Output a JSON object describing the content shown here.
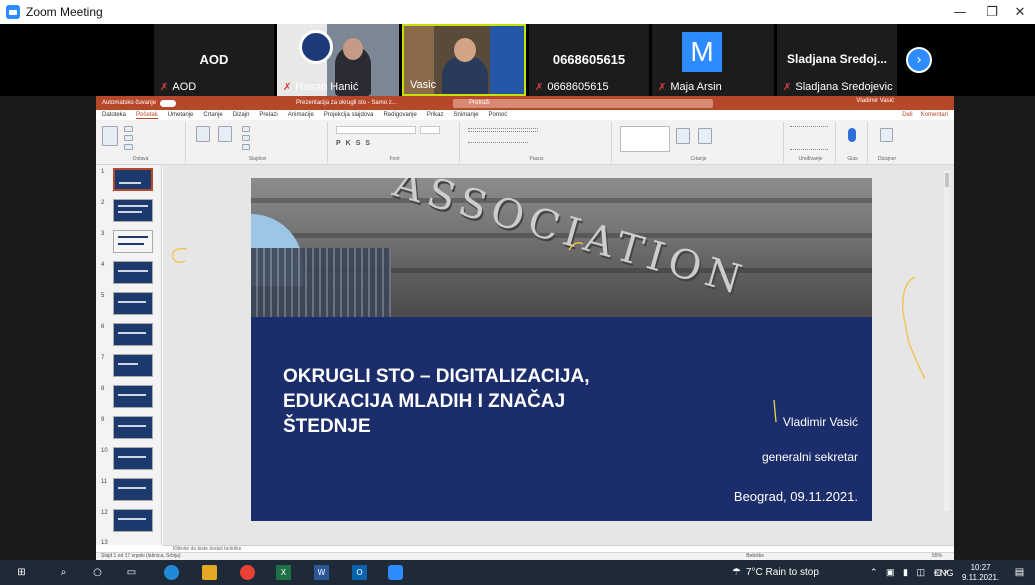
{
  "window": {
    "title": "Zoom Meeting",
    "min": "—",
    "restore": "❐",
    "close": "✕"
  },
  "participants": [
    {
      "display": "AOD",
      "name": "AOD"
    },
    {
      "display": "",
      "name": "Hasan Hanić"
    },
    {
      "display": "",
      "name": "Vasic"
    },
    {
      "display": "0668605615",
      "name": "0668605615"
    },
    {
      "display": "M",
      "name": "Maja Arsin"
    },
    {
      "display": "Sladjana Sredoj...",
      "name": "Sladjana Sredojevic"
    }
  ],
  "strip_next_icon": "chevron-right-icon",
  "ppt": {
    "autosave": "Automatsko čuvanje",
    "doc_title": "Prezentacija za okrugli sto - Samo z...",
    "search": "Pretraži",
    "user": "Vladimir Vasić",
    "menu": [
      "Datoteka",
      "Početak",
      "Umetanje",
      "Crtanje",
      "Dizajn",
      "Prelazi",
      "Animacije",
      "Projekcija slajdova",
      "Redigovanje",
      "Prikaz",
      "Snimanje",
      "Pomoć"
    ],
    "menu_active_index": 1,
    "share": "Deli",
    "comments": "Komentari",
    "groups": [
      "Ostava",
      "Slajdovi",
      "Font",
      "Pasus",
      "Crtanje",
      "Uređivanje",
      "Glas",
      "Dizajner"
    ],
    "slide_numbers": [
      "1",
      "2",
      "3",
      "4",
      "5",
      "6",
      "7",
      "8",
      "9",
      "10",
      "11",
      "12",
      "13"
    ],
    "slide": {
      "headline": [
        "OKRUGLI STO – DIGITALIZACIJA,",
        "EDUKACIJA MLADIH I ZNAČAJ",
        "ŠTEDNJE"
      ],
      "author": "Vladimir Vasić",
      "role": "generalni sekretar",
      "place_date": "Beograd, 09.11.2021."
    },
    "notes_placeholder": "Kliknite da biste dodali beleške",
    "status": "Slajd 1 od 17     srpski (latinica, Srbija)",
    "notes_btn": "Beleške",
    "zoom": "55%"
  },
  "taskbar": {
    "weather": "7°C  Rain to stop",
    "lang": "ENG",
    "time": "10:27",
    "date": "9.11.2021."
  },
  "colors": {
    "ppt_accent": "#b7472a",
    "slide_bg": "#1b2d6b",
    "zoom_blue": "#2d8cff",
    "taskbar": "#1e2a38"
  }
}
